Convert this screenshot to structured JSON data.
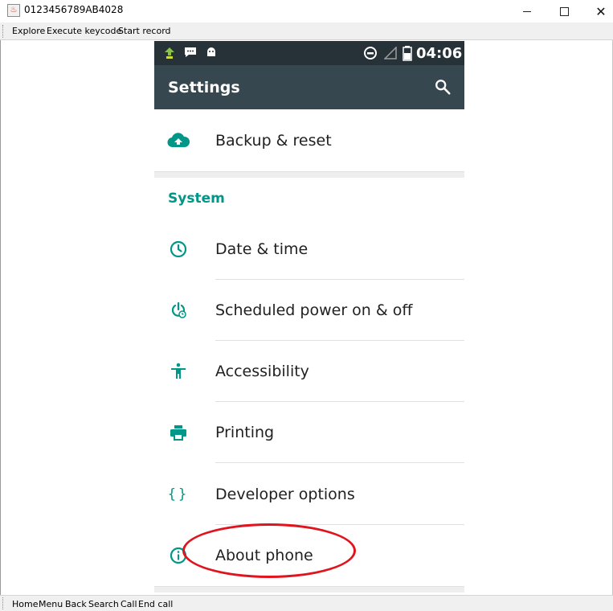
{
  "window": {
    "title": "0123456789AB4028"
  },
  "menubar": {
    "items": [
      "Explore",
      "Execute keycode",
      "Start record"
    ]
  },
  "bottombar": {
    "items": [
      "Home",
      "Menu",
      "Back",
      "Search",
      "Call",
      "End call"
    ]
  },
  "phone": {
    "status": {
      "time": "04:06"
    },
    "appbar": {
      "title": "Settings"
    },
    "backup": {
      "label": "Backup & reset",
      "icon": "cloud-upload-icon"
    },
    "system": {
      "header": "System",
      "items": [
        {
          "label": "Date & time",
          "icon": "clock-icon"
        },
        {
          "label": "Scheduled power on & off",
          "icon": "scheduled-power-icon"
        },
        {
          "label": "Accessibility",
          "icon": "accessibility-icon"
        },
        {
          "label": "Printing",
          "icon": "printer-icon"
        },
        {
          "label": "Developer options",
          "icon": "braces-icon"
        },
        {
          "label": "About phone",
          "icon": "info-icon"
        }
      ]
    },
    "accent_color": "#009688"
  },
  "annotation": {
    "color": "#e0141e",
    "target": "About phone"
  }
}
